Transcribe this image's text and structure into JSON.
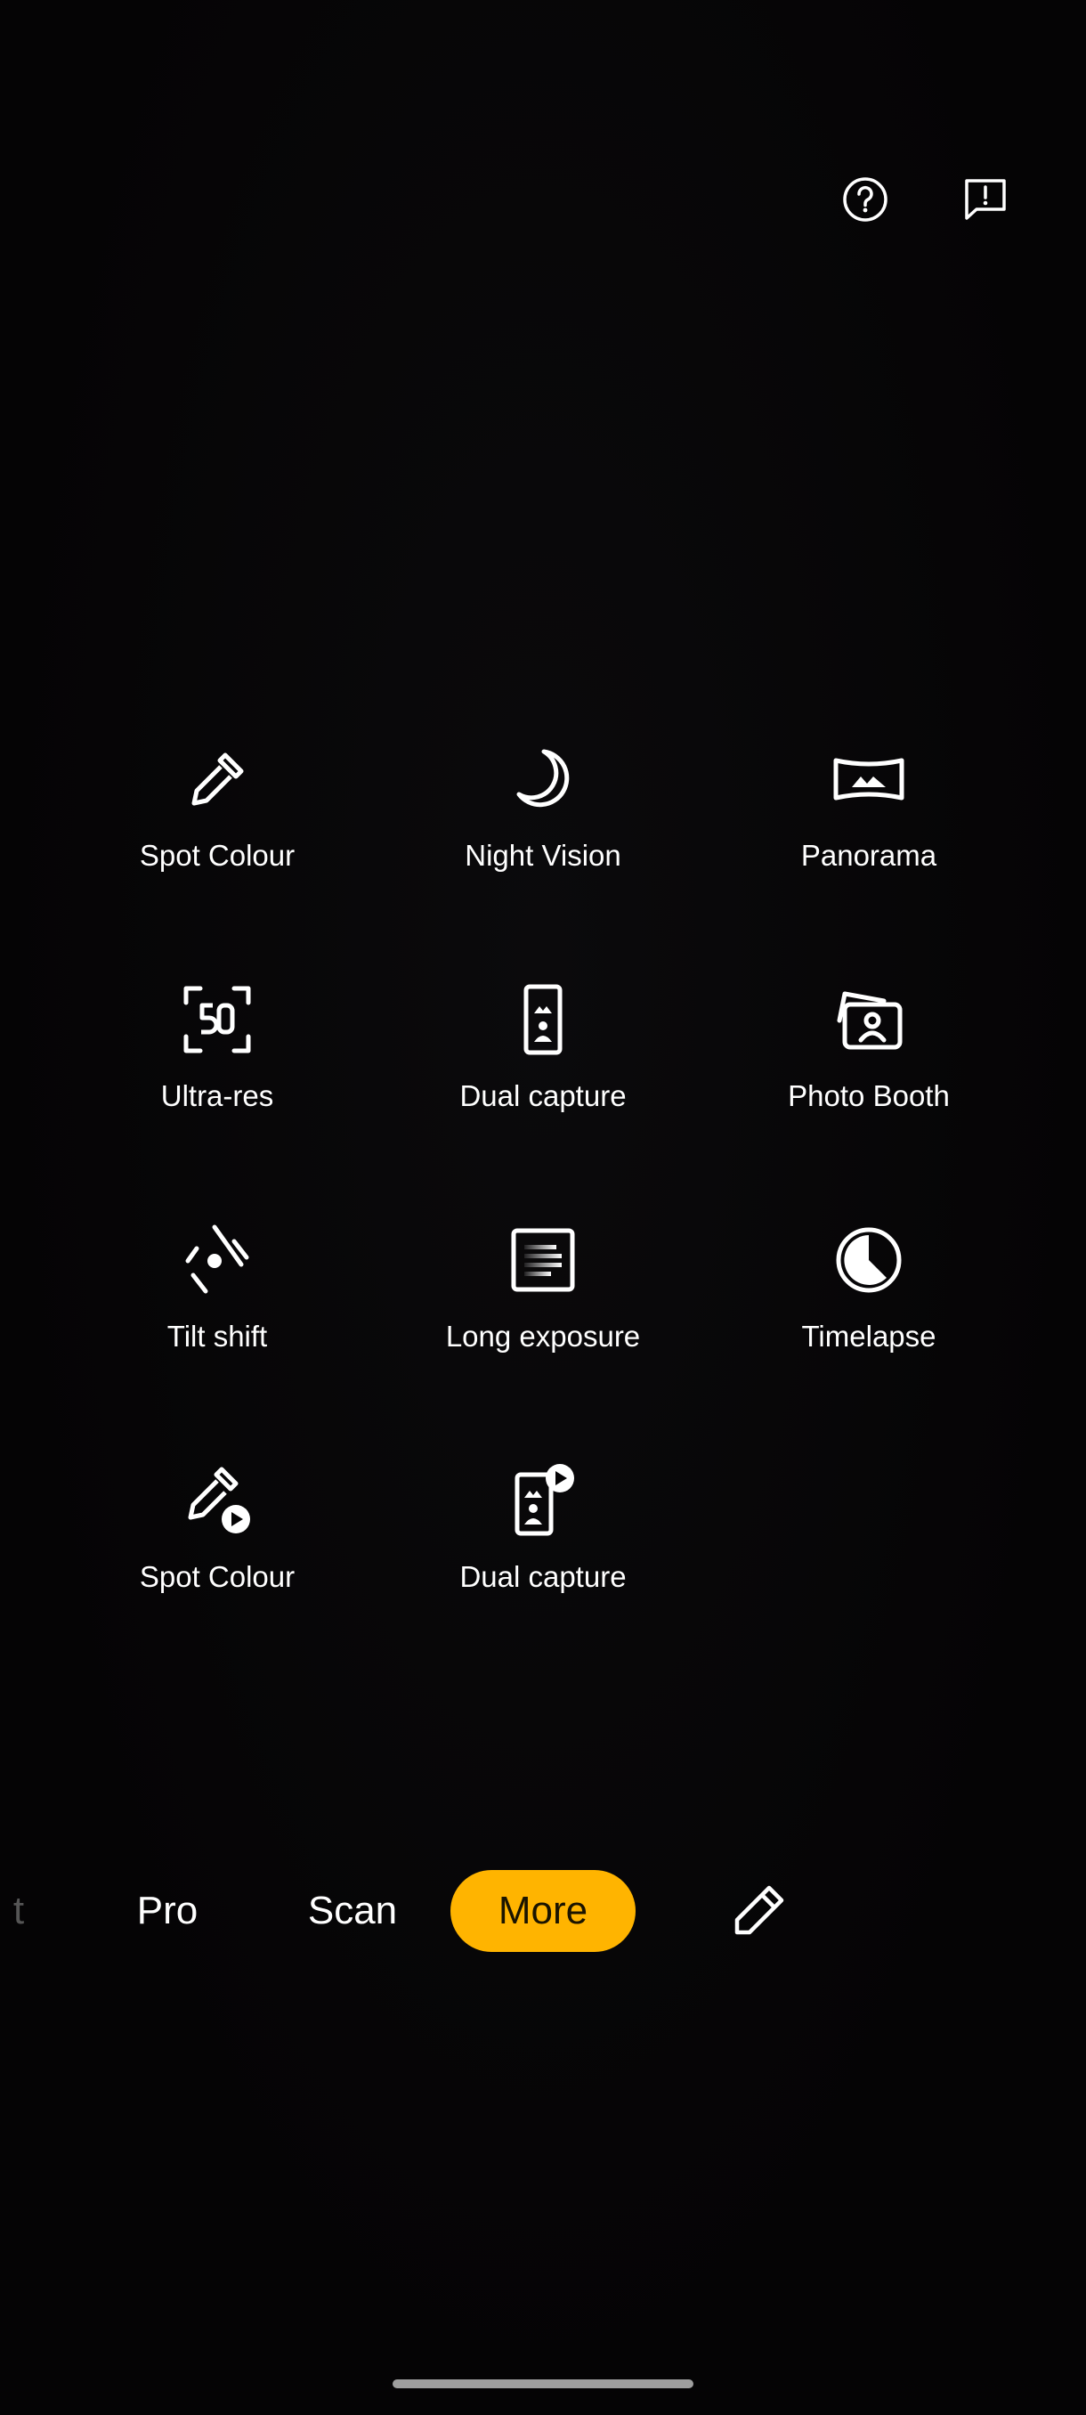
{
  "top_icons": {
    "help": "help-circle-icon",
    "feedback": "feedback-icon"
  },
  "modes": [
    {
      "label": "Spot Colour",
      "icon": "eyedropper-icon"
    },
    {
      "label": "Night Vision",
      "icon": "moon-icon"
    },
    {
      "label": "Panorama",
      "icon": "panorama-icon"
    },
    {
      "label": "Ultra-res",
      "icon": "ultra-res-50-icon"
    },
    {
      "label": "Dual capture",
      "icon": "dual-capture-icon"
    },
    {
      "label": "Photo Booth",
      "icon": "photo-booth-icon"
    },
    {
      "label": "Tilt shift",
      "icon": "tilt-shift-icon"
    },
    {
      "label": "Long exposure",
      "icon": "long-exposure-icon"
    },
    {
      "label": "Timelapse",
      "icon": "timelapse-icon"
    },
    {
      "label": "Spot Colour",
      "icon": "eyedropper-video-icon"
    },
    {
      "label": "Dual capture",
      "icon": "dual-capture-video-icon"
    }
  ],
  "mode_bar": {
    "partial": "t",
    "pro": "Pro",
    "scan": "Scan",
    "more": "More",
    "edit_icon": "pencil-icon"
  },
  "colors": {
    "accent": "#ffb400",
    "background": "#050405"
  }
}
